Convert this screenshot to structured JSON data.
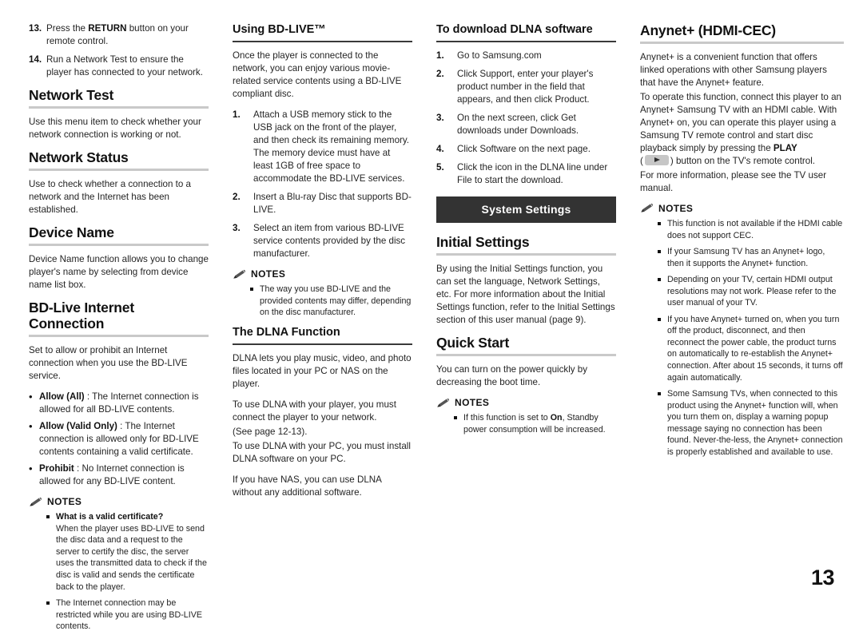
{
  "page": {
    "number": "13"
  },
  "icons": {
    "notes": "pencil-icon",
    "play_key": "play-button-key-icon"
  },
  "colors": {
    "banner_bg": "#333333",
    "rule_grey": "#c9c9c9",
    "rule_dark": "#3a3a3a",
    "text": "#242424"
  },
  "column1": {
    "steps": [
      {
        "num": "13.",
        "pre": "Press the ",
        "bold": "RETURN",
        "post": " button on your remote control."
      },
      {
        "num": "14.",
        "pre": "Run a Network Test to ensure the player has connected to your network.",
        "bold": "",
        "post": ""
      }
    ],
    "network_test": {
      "heading": "Network Test",
      "body": "Use this menu item to check whether your network connection is working or not."
    },
    "network_status": {
      "heading": "Network Status",
      "body": "Use to check whether a connection to a network and the Internet has been established."
    },
    "device_name": {
      "heading": "Device Name",
      "body": "Device Name function allows you to change player's name by selecting from device name list box."
    },
    "bdlive": {
      "heading": "BD-Live Internet Connection",
      "body": "Set to allow or prohibit an Internet connection when you use the BD-LIVE service.",
      "options": [
        {
          "label": "Allow (All)",
          "text": " : The Internet connection is allowed for all BD-LIVE contents."
        },
        {
          "label": "Allow (Valid Only)",
          "text": " : The Internet connection is allowed only for BD-LIVE contents containing a valid certificate."
        },
        {
          "label": "Prohibit",
          "text": " : No Internet connection is allowed for any BD-LIVE content."
        }
      ],
      "notes_title": "NOTES",
      "notes": [
        {
          "bold": "What is a valid certificate?",
          "text": "When the player uses BD-LIVE to send the disc data and a request to the server to certify the disc, the server uses the transmitted data to check if the disc is valid and sends the certificate back to the player."
        },
        {
          "bold": "",
          "text": "The Internet connection may be restricted while you are using BD-LIVE contents."
        }
      ]
    }
  },
  "column2": {
    "using_bdlive": {
      "heading": "Using BD-LIVE™",
      "body": "Once the player is connected to the network, you can enjoy various movie-related service contents using a BD-LIVE compliant disc.",
      "steps": [
        {
          "num": "1.",
          "text": "Attach a USB memory stick to the USB jack on the front of the player, and then check its remaining memory. The memory device must have at least 1GB of free space to accommodate the BD-LIVE services."
        },
        {
          "num": "2.",
          "text": "Insert a Blu-ray Disc that supports BD-LIVE."
        },
        {
          "num": "3.",
          "text": "Select an item from various BD-LIVE service contents provided by the disc manufacturer."
        }
      ],
      "notes_title": "NOTES",
      "notes": [
        {
          "bold": "",
          "text": "The way you use BD-LIVE and the provided contents may differ, depending on the disc manufacturer."
        }
      ]
    },
    "dlna": {
      "heading": "The DLNA Function",
      "paras": [
        "DLNA lets you play music, video, and photo files located in your PC or NAS on the player.",
        "To use DLNA with your player, you must connect the player to your network.",
        "(See page 12-13).",
        "To use DLNA with your PC, you must install DLNA software on your PC.",
        "If you have NAS, you can use DLNA without any additional software."
      ]
    }
  },
  "column3": {
    "download_dlna": {
      "heading": "To download DLNA software",
      "steps": [
        {
          "num": "1.",
          "text": "Go to Samsung.com"
        },
        {
          "num": "2.",
          "text": "Click Support, enter your player's product number in the field that appears, and then click Product."
        },
        {
          "num": "3.",
          "text": "On the next screen, click Get downloads under Downloads."
        },
        {
          "num": "4.",
          "text": "Click Software on the next page."
        },
        {
          "num": "5.",
          "text": "Click the icon in the DLNA line under File to start the download."
        }
      ]
    },
    "banner": "System Settings",
    "initial_settings": {
      "heading": "Initial Settings",
      "body": "By using the Initial Settings function, you can set the language, Network Settings, etc. For more information about the Initial Settings function, refer to the Initial Settings section of this user manual (page 9)."
    },
    "quick_start": {
      "heading": "Quick Start",
      "body": "You can turn on the power quickly by decreasing the boot time.",
      "notes_title": "NOTES",
      "note_pre": "If this function is set to ",
      "note_bold": "On",
      "note_post": ", Standby power consumption will be increased."
    }
  },
  "column4": {
    "anynet": {
      "heading": "Anynet+ (HDMI-CEC)",
      "para1": "Anynet+ is a convenient function that offers linked operations with other Samsung players that have the Anynet+ feature.",
      "para2_pre": "To operate this function, connect this player to an Anynet+ Samsung TV with an HDMI cable. With Anynet+ on, you can operate this player using a Samsung TV remote control and start disc playback simply by pressing the ",
      "para2_bold": "PLAY",
      "para2_mid": "(",
      "para2_post": ") button on the TV's remote control.",
      "para3": "For more information, please see the TV user manual.",
      "notes_title": "NOTES",
      "notes": [
        "This function is not available if the HDMI cable does not support CEC.",
        "If your Samsung TV has an Anynet+ logo, then it supports the Anynet+ function.",
        "Depending on your TV, certain HDMI output resolutions may not work. Please refer to the user manual of your TV.",
        "If you have Anynet+ turned on, when you turn off the product, disconnect, and then reconnect the power cable, the product turns on automatically to re-establish the Anynet+ connection. After about 15 seconds, it turns off again automatically.",
        "Some Samsung TVs, when connected to this product using the Anynet+ function will, when you turn them on, display a warning popup message saying no connection has been found. Never-the-less, the Anynet+ connection is properly established and available to use."
      ]
    }
  }
}
